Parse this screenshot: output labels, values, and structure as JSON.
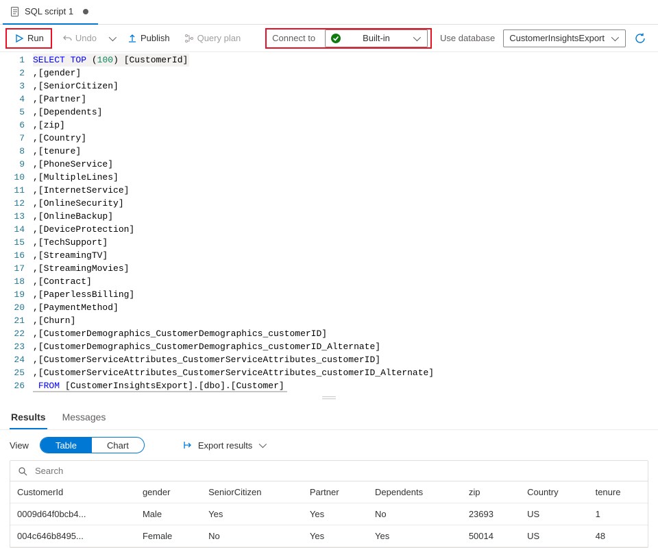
{
  "tab": {
    "title": "SQL script 1"
  },
  "toolbar": {
    "run": "Run",
    "undo": "Undo",
    "publish": "Publish",
    "query_plan": "Query plan",
    "connect_to": "Connect to",
    "connect_value": "Built-in",
    "use_database": "Use database",
    "database_value": "CustomerInsightsExport"
  },
  "code": {
    "lines": [
      {
        "n": 1,
        "type": "select",
        "kw1": "SELECT",
        "kw2": "TOP",
        "num": "100",
        "col": "[CustomerId]"
      },
      {
        "n": 2,
        "type": "col",
        "col": "[gender]"
      },
      {
        "n": 3,
        "type": "col",
        "col": "[SeniorCitizen]"
      },
      {
        "n": 4,
        "type": "col",
        "col": "[Partner]"
      },
      {
        "n": 5,
        "type": "col",
        "col": "[Dependents]"
      },
      {
        "n": 6,
        "type": "col",
        "col": "[zip]"
      },
      {
        "n": 7,
        "type": "col",
        "col": "[Country]"
      },
      {
        "n": 8,
        "type": "col",
        "col": "[tenure]"
      },
      {
        "n": 9,
        "type": "col",
        "col": "[PhoneService]"
      },
      {
        "n": 10,
        "type": "col",
        "col": "[MultipleLines]"
      },
      {
        "n": 11,
        "type": "col",
        "col": "[InternetService]"
      },
      {
        "n": 12,
        "type": "col",
        "col": "[OnlineSecurity]"
      },
      {
        "n": 13,
        "type": "col",
        "col": "[OnlineBackup]"
      },
      {
        "n": 14,
        "type": "col",
        "col": "[DeviceProtection]"
      },
      {
        "n": 15,
        "type": "col",
        "col": "[TechSupport]"
      },
      {
        "n": 16,
        "type": "col",
        "col": "[StreamingTV]"
      },
      {
        "n": 17,
        "type": "col",
        "col": "[StreamingMovies]"
      },
      {
        "n": 18,
        "type": "col",
        "col": "[Contract]"
      },
      {
        "n": 19,
        "type": "col",
        "col": "[PaperlessBilling]"
      },
      {
        "n": 20,
        "type": "col",
        "col": "[PaymentMethod]"
      },
      {
        "n": 21,
        "type": "col",
        "col": "[Churn]"
      },
      {
        "n": 22,
        "type": "col",
        "col": "[CustomerDemographics_CustomerDemographics_customerID]"
      },
      {
        "n": 23,
        "type": "col",
        "col": "[CustomerDemographics_CustomerDemographics_customerID_Alternate]"
      },
      {
        "n": 24,
        "type": "col",
        "col": "[CustomerServiceAttributes_CustomerServiceAttributes_customerID]"
      },
      {
        "n": 25,
        "type": "col",
        "col": "[CustomerServiceAttributes_CustomerServiceAttributes_customerID_Alternate]"
      },
      {
        "n": 26,
        "type": "from",
        "kw1": "FROM",
        "col": "[CustomerInsightsExport].[dbo].[Customer]"
      }
    ]
  },
  "results": {
    "tabs": {
      "results": "Results",
      "messages": "Messages"
    },
    "view_label": "View",
    "pill_table": "Table",
    "pill_chart": "Chart",
    "export": "Export results",
    "search_placeholder": "Search",
    "columns": [
      "CustomerId",
      "gender",
      "SeniorCitizen",
      "Partner",
      "Dependents",
      "zip",
      "Country",
      "tenure"
    ],
    "rows": [
      [
        "0009d64f0bcb4...",
        "Male",
        "Yes",
        "Yes",
        "No",
        "23693",
        "US",
        "1"
      ],
      [
        "004c646b8495...",
        "Female",
        "No",
        "Yes",
        "Yes",
        "50014",
        "US",
        "48"
      ]
    ]
  }
}
